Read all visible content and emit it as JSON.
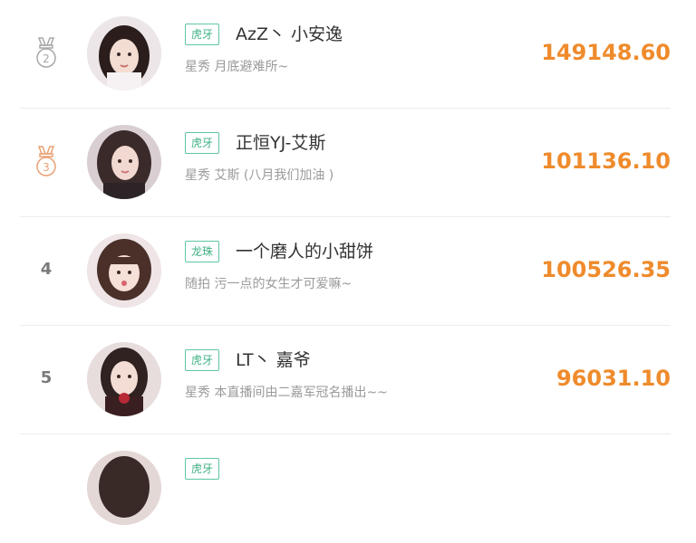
{
  "rows": [
    {
      "rank": "2",
      "platform": "虎牙",
      "name": "AzZ丶 小安逸",
      "desc": "星秀 月底避难所~",
      "score": "149148.60",
      "medal_color": "#a8a8a8"
    },
    {
      "rank": "3",
      "platform": "虎牙",
      "name": "正恒YJ-艾斯",
      "desc": "星秀 艾斯 (八月我们加油 )",
      "score": "101136.10",
      "medal_color": "#e8a174"
    },
    {
      "rank": "4",
      "platform": "龙珠",
      "name": "一个磨人的小甜饼",
      "desc": "随拍 污一点的女生才可爱嘛~",
      "score": "100526.35"
    },
    {
      "rank": "5",
      "platform": "虎牙",
      "name": "LT丶 嘉爷",
      "desc": "星秀 本直播间由二嘉军冠名播出~~",
      "score": "96031.10"
    },
    {
      "platform": "虎牙"
    }
  ]
}
